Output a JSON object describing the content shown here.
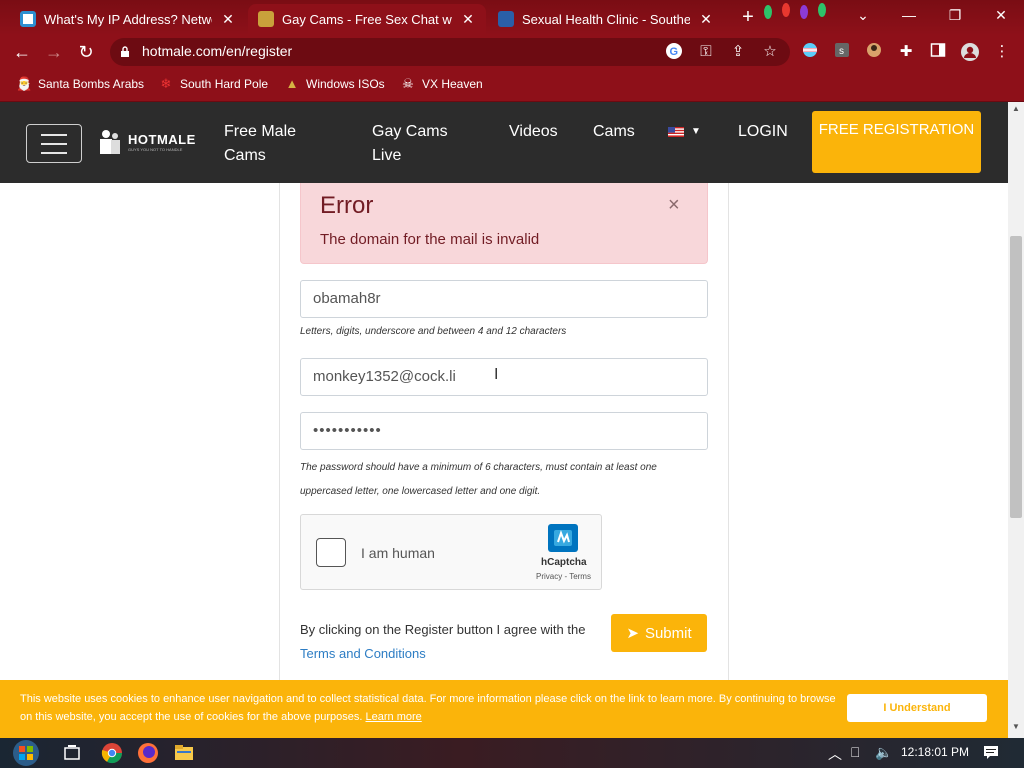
{
  "browser": {
    "tabs": [
      {
        "title": "What's My IP Address? Network",
        "active": false
      },
      {
        "title": "Gay Cams - Free Sex Chat with S",
        "active": true
      },
      {
        "title": "Sexual Health Clinic - Southern",
        "active": false
      }
    ],
    "url": "hotmale.com/en/register",
    "bookmarks": [
      "Santa Bombs Arabs",
      "South Hard Pole",
      "Windows ISOs",
      "VX Heaven"
    ],
    "theme_color": "#8e1019"
  },
  "site": {
    "logo": "HOTMALE",
    "tagline": "GUYS YOU NOT TO HANDLE",
    "nav": {
      "free_male_cams": "Free Male Cams",
      "gay_cams_live": "Gay Cams Live",
      "videos": "Videos",
      "cams": "Cams",
      "login": "LOGIN"
    },
    "register_button": "FREE REGISTRATION",
    "accent_color": "#fbb40a"
  },
  "alert": {
    "title": "Error",
    "message": "The domain for the mail is invalid",
    "close": "×"
  },
  "form": {
    "username": "obamah8r",
    "username_hint": "Letters, digits, underscore and between 4 and 12 characters",
    "email": "monkey1352@cock.li",
    "password": "•••••••••••",
    "password_hint": "The password should have a minimum of 6 characters, must contain at least one uppercased letter, one lowercased letter and one digit.",
    "captcha_label": "I am human",
    "captcha_brand": "hCaptcha",
    "captcha_links": "Privacy - Terms",
    "agree_text": "By clicking on the Register button I agree with the",
    "terms_link": "Terms and Conditions",
    "submit": "Submit"
  },
  "cookie": {
    "text": "This website uses cookies to enhance user navigation and to collect statistical data. For more information please click on the link to learn more. By continuing to browse on this website, you accept the use of cookies for the above purposes.",
    "learn_more": "Learn more",
    "button": "I Understand"
  },
  "taskbar": {
    "time": "12:18:01 PM"
  }
}
